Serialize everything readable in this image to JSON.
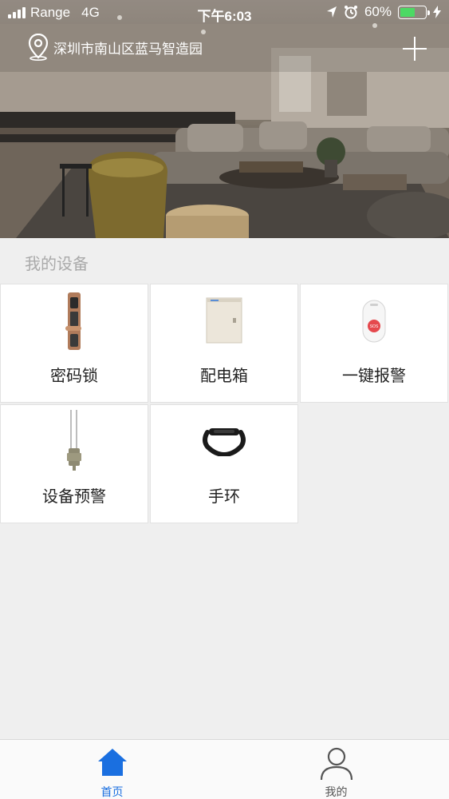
{
  "status_bar": {
    "carrier": "Range",
    "network": "4G",
    "time": "下午6:03",
    "battery_percent": "60%",
    "battery_level": 0.6
  },
  "header": {
    "location": "深圳市南山区蓝马智造园",
    "location_icon": "location-pin-icon",
    "add_icon": "plus-icon"
  },
  "section": {
    "title": "我的设备"
  },
  "devices": [
    {
      "label": "密码锁",
      "icon": "smart-lock-icon"
    },
    {
      "label": "配电箱",
      "icon": "distribution-box-icon"
    },
    {
      "label": "一键报警",
      "icon": "sos-button-icon"
    },
    {
      "label": "设备预警",
      "icon": "sensor-icon"
    },
    {
      "label": "手环",
      "icon": "wristband-icon"
    }
  ],
  "tabbar": {
    "items": [
      {
        "label": "首页",
        "icon": "home-icon",
        "active": true
      },
      {
        "label": "我的",
        "icon": "user-icon",
        "active": false
      }
    ],
    "active_color": "#1a6fe0",
    "inactive_color": "#555555"
  }
}
